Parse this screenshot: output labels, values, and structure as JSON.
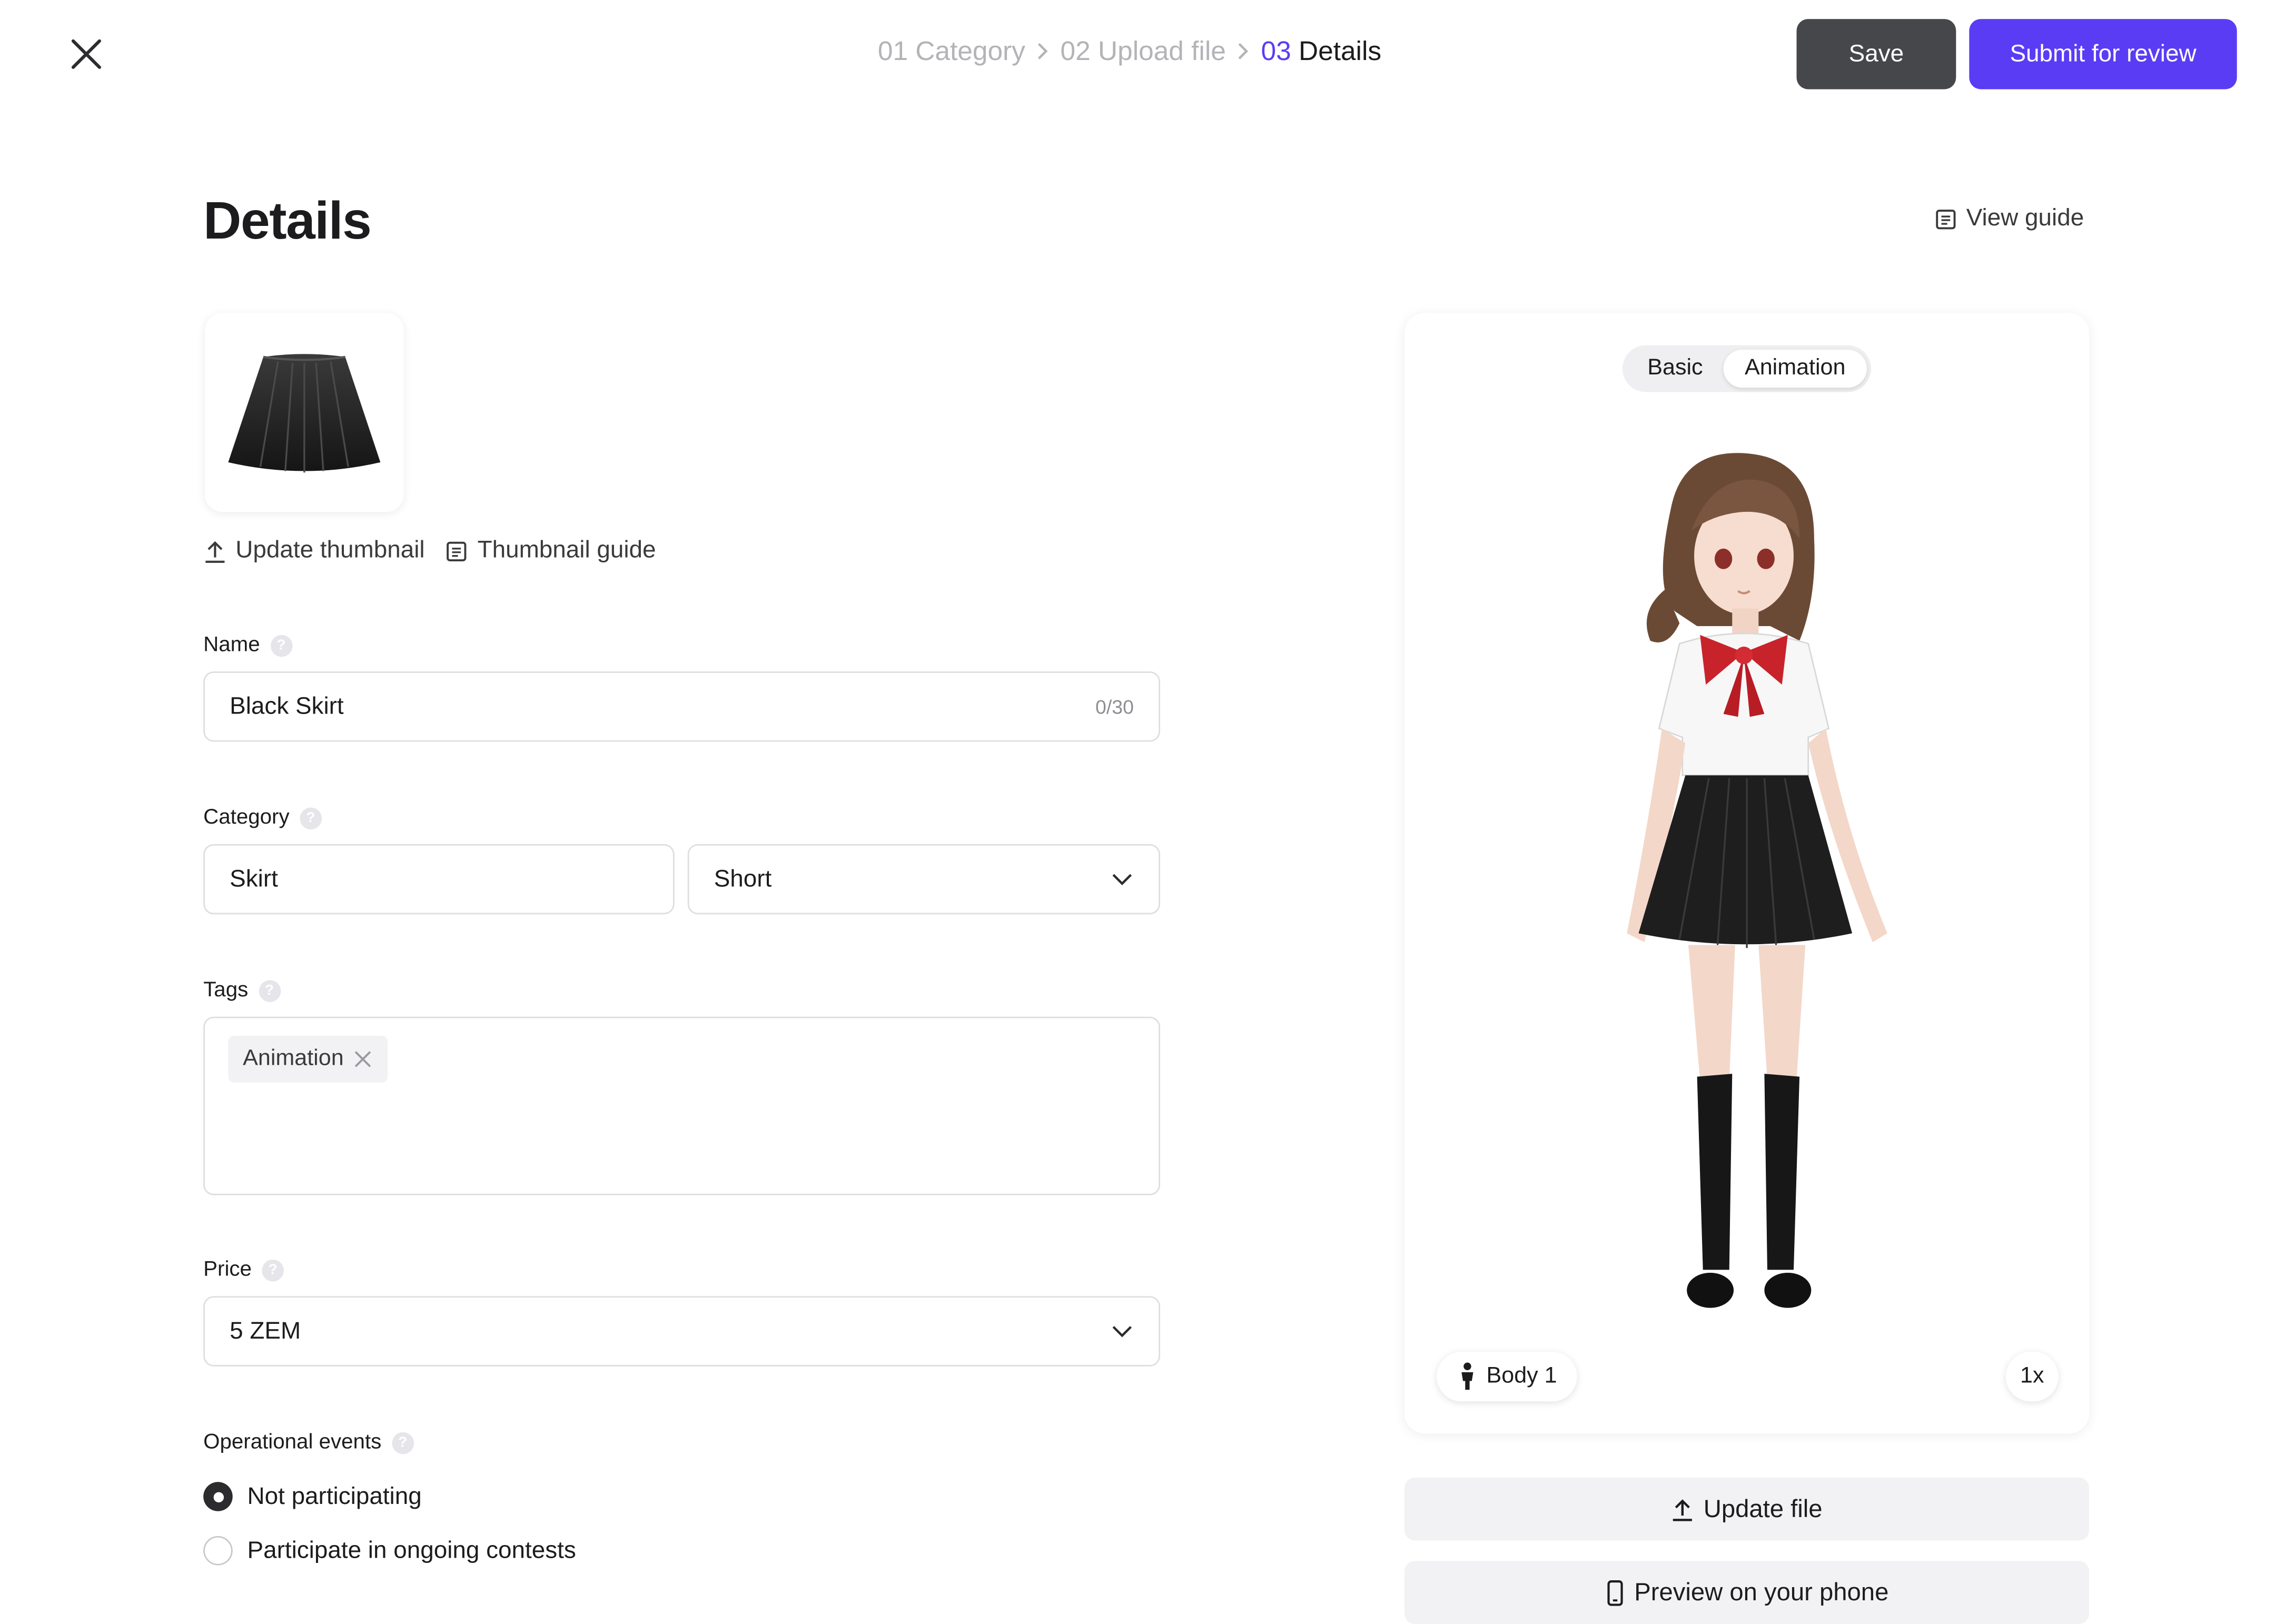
{
  "header": {
    "breadcrumb": [
      {
        "num": "01",
        "label": "Category"
      },
      {
        "num": "02",
        "label": "Upload file"
      },
      {
        "num": "03",
        "label": "Details"
      }
    ],
    "save_label": "Save",
    "submit_label": "Submit for review"
  },
  "page": {
    "title": "Details",
    "view_guide": "View guide"
  },
  "thumbnail": {
    "update_label": "Update thumbnail",
    "guide_label": "Thumbnail guide"
  },
  "form": {
    "name": {
      "label": "Name",
      "value": "Black Skirt",
      "counter": "0/30"
    },
    "category": {
      "label": "Category",
      "primary": "Skirt",
      "secondary": "Short"
    },
    "tags": {
      "label": "Tags",
      "items": [
        "Animation"
      ]
    },
    "price": {
      "label": "Price",
      "value": "5 ZEM"
    },
    "events": {
      "label": "Operational events",
      "options": [
        "Not participating",
        "Participate in ongoing contests"
      ],
      "selected": "Not participating"
    }
  },
  "preview": {
    "tabs": [
      "Basic",
      "Animation"
    ],
    "active_tab": "Animation",
    "body_label": "Body 1",
    "speed": "1x",
    "update_file": "Update file",
    "preview_phone": "Preview on your phone"
  },
  "colors": {
    "accent": "#5b3cf5",
    "save_button": "#46474b"
  }
}
